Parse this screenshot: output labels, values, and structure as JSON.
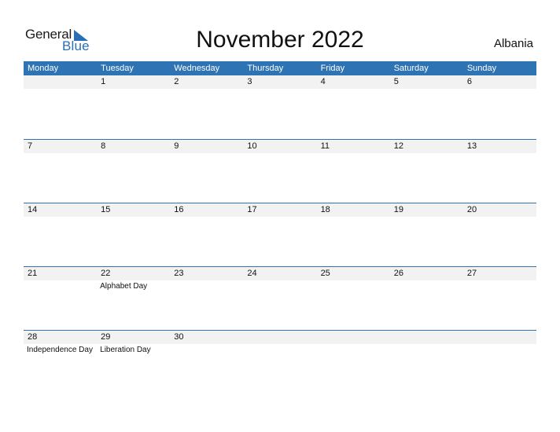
{
  "logo": {
    "line1": "General",
    "line2": "Blue",
    "accent_color": "#2a6fb5",
    "icon": "triangle-flag-icon"
  },
  "title": "November 2022",
  "country": "Albania",
  "colors": {
    "header_bg": "#2e74b5",
    "header_text": "#ffffff",
    "date_strip_bg": "#f2f2f2"
  },
  "weekdays": [
    "Monday",
    "Tuesday",
    "Wednesday",
    "Thursday",
    "Friday",
    "Saturday",
    "Sunday"
  ],
  "weeks": [
    {
      "days": [
        {
          "day": "",
          "holiday": ""
        },
        {
          "day": "1",
          "holiday": ""
        },
        {
          "day": "2",
          "holiday": ""
        },
        {
          "day": "3",
          "holiday": ""
        },
        {
          "day": "4",
          "holiday": ""
        },
        {
          "day": "5",
          "holiday": ""
        },
        {
          "day": "6",
          "holiday": ""
        }
      ]
    },
    {
      "days": [
        {
          "day": "7",
          "holiday": ""
        },
        {
          "day": "8",
          "holiday": ""
        },
        {
          "day": "9",
          "holiday": ""
        },
        {
          "day": "10",
          "holiday": ""
        },
        {
          "day": "11",
          "holiday": ""
        },
        {
          "day": "12",
          "holiday": ""
        },
        {
          "day": "13",
          "holiday": ""
        }
      ]
    },
    {
      "days": [
        {
          "day": "14",
          "holiday": ""
        },
        {
          "day": "15",
          "holiday": ""
        },
        {
          "day": "16",
          "holiday": ""
        },
        {
          "day": "17",
          "holiday": ""
        },
        {
          "day": "18",
          "holiday": ""
        },
        {
          "day": "19",
          "holiday": ""
        },
        {
          "day": "20",
          "holiday": ""
        }
      ]
    },
    {
      "days": [
        {
          "day": "21",
          "holiday": ""
        },
        {
          "day": "22",
          "holiday": "Alphabet Day"
        },
        {
          "day": "23",
          "holiday": ""
        },
        {
          "day": "24",
          "holiday": ""
        },
        {
          "day": "25",
          "holiday": ""
        },
        {
          "day": "26",
          "holiday": ""
        },
        {
          "day": "27",
          "holiday": ""
        }
      ]
    },
    {
      "days": [
        {
          "day": "28",
          "holiday": "Independence Day"
        },
        {
          "day": "29",
          "holiday": "Liberation Day"
        },
        {
          "day": "30",
          "holiday": ""
        },
        {
          "day": "",
          "holiday": ""
        },
        {
          "day": "",
          "holiday": ""
        },
        {
          "day": "",
          "holiday": ""
        },
        {
          "day": "",
          "holiday": ""
        }
      ]
    }
  ]
}
